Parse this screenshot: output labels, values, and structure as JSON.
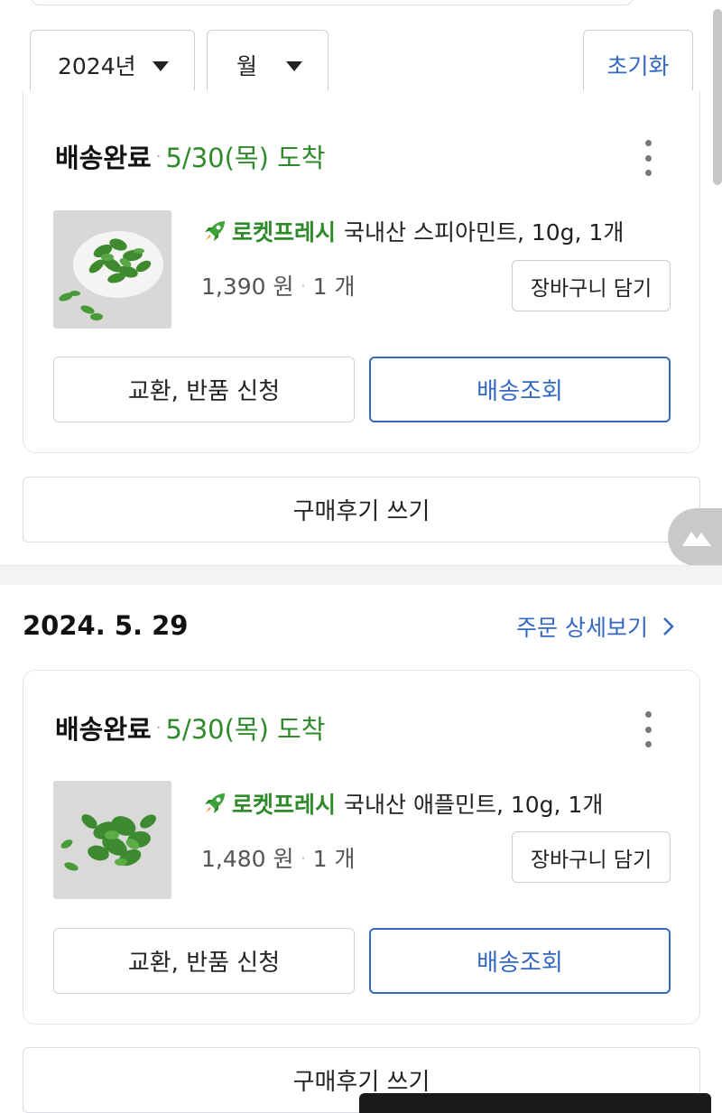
{
  "filters": {
    "year": "2024년",
    "month": "월",
    "reset": "초기화"
  },
  "orders": [
    {
      "status": "배송완료",
      "arrival": "5/30(목) 도착",
      "rocket_label": "로켓프레시",
      "product_name": "국내산 스피아민트, 10g, 1개",
      "price": "1,390 원",
      "quantity": "1 개",
      "cart_button": "장바구니 담기",
      "exchange_button": "교환, 반품 신청",
      "track_button": "배송조회",
      "review_button": "구매후기 쓰기"
    },
    {
      "date": "2024. 5. 29",
      "detail_link": "주문 상세보기",
      "status": "배송완료",
      "arrival": "5/30(목) 도착",
      "rocket_label": "로켓프레시",
      "product_name": "국내산 애플민트, 10g, 1개",
      "price": "1,480 원",
      "quantity": "1 개",
      "cart_button": "장바구니 담기",
      "exchange_button": "교환, 반품 신청",
      "track_button": "배송조회",
      "review_button": "구매후기 쓰기"
    }
  ],
  "colors": {
    "accent_blue": "#3468c3",
    "arrival_green": "#2f8a2a",
    "rocket_green": "#2f8a2a"
  },
  "icons": {
    "filter_caret": "caret-down-icon",
    "more": "more-vertical-icon",
    "rocket": "rocket-icon",
    "detail_chevron": "chevron-right-icon",
    "floating": "mountain-icon"
  }
}
